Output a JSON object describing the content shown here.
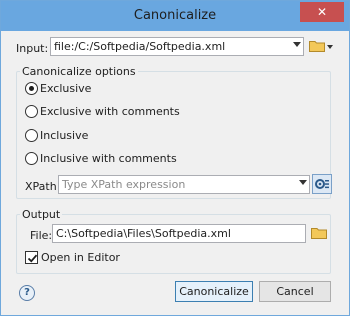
{
  "window": {
    "title": "Canonicalize",
    "close_glyph": "✕"
  },
  "input": {
    "label": "Input:",
    "value": "file:/C:/Softpedia/Softpedia.xml"
  },
  "options_group": {
    "title": "Canonicalize options",
    "radios": [
      {
        "label": "Exclusive",
        "checked": true
      },
      {
        "label": "Exclusive with comments",
        "checked": false
      },
      {
        "label": "Inclusive",
        "checked": false
      },
      {
        "label": "Inclusive with comments",
        "checked": false
      }
    ],
    "xpath_label": "XPath:",
    "xpath_placeholder": "Type XPath expression"
  },
  "output_group": {
    "title": "Output",
    "file_label": "File:",
    "file_value": "C:\\Softpedia\\Files\\Softpedia.xml",
    "open_in_editor_label": "Open in Editor",
    "open_in_editor_checked": true
  },
  "buttons": {
    "help_glyph": "?",
    "canonicalize": "Canonicalize",
    "cancel": "Cancel"
  },
  "colors": {
    "titlebar": "#69a7e0",
    "close": "#c75050",
    "folder": "#e8b84a"
  }
}
